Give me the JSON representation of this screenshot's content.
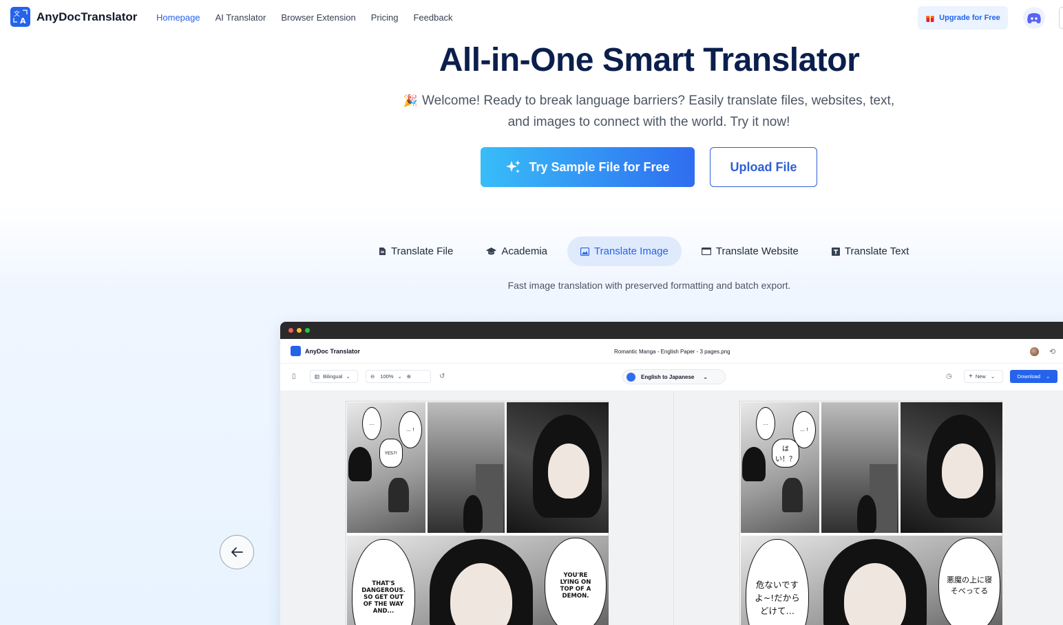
{
  "brand": {
    "name": "AnyDocTranslator"
  },
  "nav": {
    "links": [
      "Homepage",
      "AI Translator",
      "Browser Extension",
      "Pricing",
      "Feedback"
    ],
    "upgrade_label": "Upgrade for Free"
  },
  "hero": {
    "title": "All-in-One Smart Translator",
    "subtitle": "Welcome! Ready to break language barriers? Easily translate files, websites, text, and images to connect with the world. Try it now!",
    "primary_button": "Try Sample File for Free",
    "secondary_button": "Upload File"
  },
  "tabs": {
    "items": [
      "Translate File",
      "Academia",
      "Translate Image",
      "Translate Website",
      "Translate Text"
    ],
    "active": "Translate Image",
    "description": "Fast image translation with preserved formatting and batch export."
  },
  "app": {
    "name": "AnyDoc Translator",
    "file_name": "Romantic Manga - English Paper - 3 pages.png",
    "view_mode": "Bilingual",
    "zoom": "100%",
    "language": "English to Japanese",
    "new_label": "New",
    "download_label": "Download"
  },
  "manga_original": {
    "b1": "...",
    "b2": "... !",
    "b3": "YES?!",
    "b4": "THAT'S DANGEROUS. SO GET OUT OF THE WAY AND...",
    "b5": "YOU'RE LYING ON TOP OF A DEMON."
  },
  "manga_translated": {
    "b1": "...",
    "b2": "... !",
    "b3": "はい！？",
    "b4": "危ないです よ~!だから どけて…",
    "b5": "悪魔の上に寝 そべってる"
  },
  "colors": {
    "accent": "#2563eb",
    "title": "#0b1f4d",
    "tab_active_bg": "#dfeafc"
  }
}
